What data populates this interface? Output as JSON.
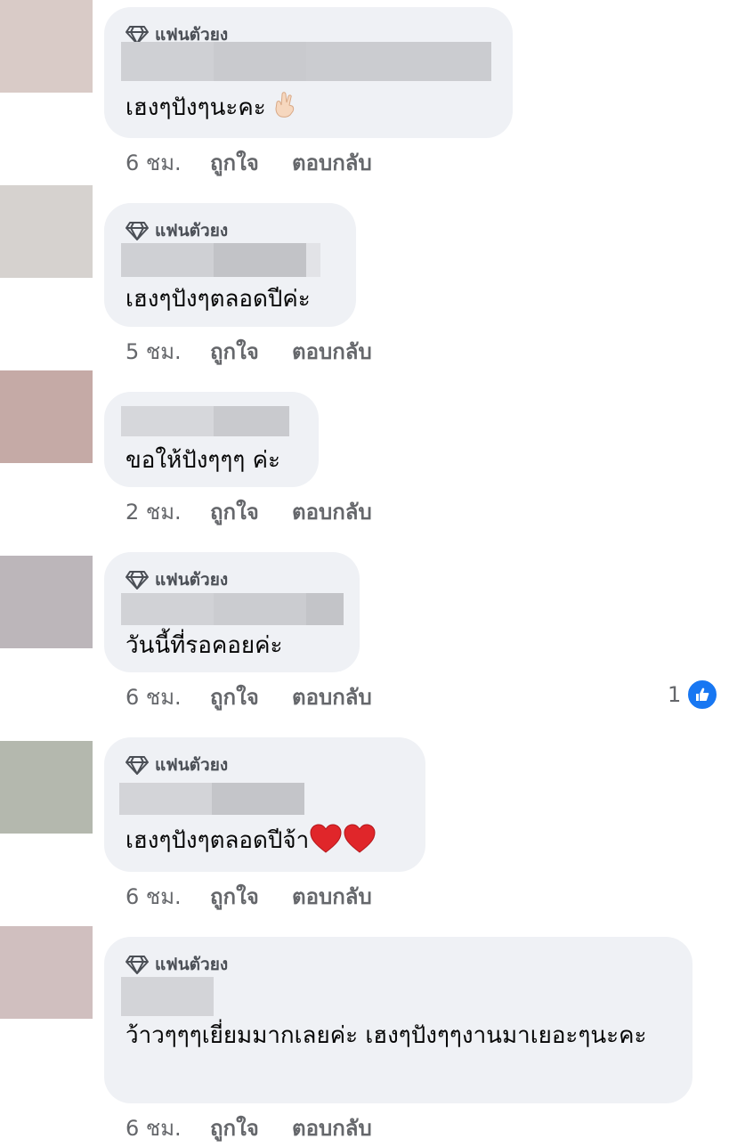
{
  "badge_label": "แฟนตัวยง",
  "comments": [
    {
      "text": "เฮงๆปังๆนะคะ",
      "time": "6 ชม.",
      "like": "ถูกใจ",
      "reply": "ตอบกลับ",
      "avatar_color": "#d9cbc7"
    },
    {
      "text": "เฮงๆปังๆตลอดปีค่ะ",
      "time": "5 ชม.",
      "like": "ถูกใจ",
      "reply": "ตอบกลับ",
      "avatar_color": "#d6d2cf"
    },
    {
      "text": "ขอให้ปังๆๆๆ ค่ะ",
      "time": "2 ชม.",
      "like": "ถูกใจ",
      "reply": "ตอบกลับ",
      "avatar_color": "#c5aaa6"
    },
    {
      "text": "วันนี้ที่รอคอยค่ะ",
      "time": "6 ชม.",
      "like": "ถูกใจ",
      "reply": "ตอบกลับ",
      "avatar_color": "#bcb6ba",
      "reaction_count": "1"
    },
    {
      "text": "เฮงๆปังๆตลอดปีจ้า",
      "time": "6 ชม.",
      "like": "ถูกใจ",
      "reply": "ตอบกลับ",
      "avatar_color": "#b4b8ae"
    },
    {
      "text": "ว้าวๆๆๆเยี่ยมมากเลยค่ะ เฮงๆปังๆๆงานมาเยอะๆนะคะ",
      "time": "6 ชม.",
      "like": "ถูกใจ",
      "reply": "ตอบกลับ",
      "avatar_color": "#d0bfbf"
    }
  ],
  "colors": {
    "bubble": "#eff1f5",
    "meta_text": "#65676b",
    "like_blue": "#1877f2",
    "heart_red": "#e0262a"
  },
  "icons": {
    "badge": "diamond-icon",
    "reaction": "thumbs-up-icon",
    "emoji_1": "crossed-fingers-emoji",
    "emoji_5": "red-heart-emoji"
  }
}
